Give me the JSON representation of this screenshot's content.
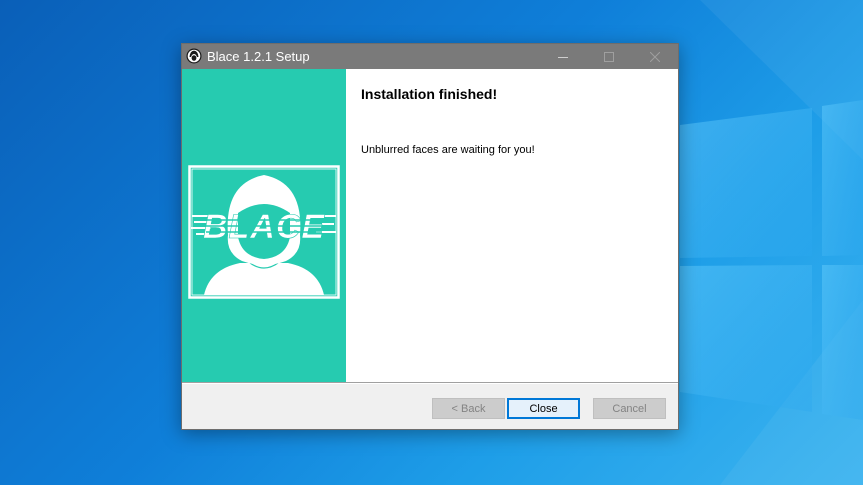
{
  "window": {
    "title": "Blace 1.2.1 Setup",
    "controls": [
      "minimize-icon",
      "maximize-icon",
      "close-icon"
    ]
  },
  "sidebar": {
    "logo_text": "BLACE",
    "accent_color": "#26cbb0"
  },
  "content": {
    "heading": "Installation finished!",
    "message": "Unblurred faces are waiting for you!"
  },
  "buttons": {
    "back_label": "< Back",
    "close_label": "Close",
    "cancel_label": "Cancel"
  },
  "colors": {
    "titlebar": "#7a7a7a",
    "default_button_border": "#0078d7"
  }
}
